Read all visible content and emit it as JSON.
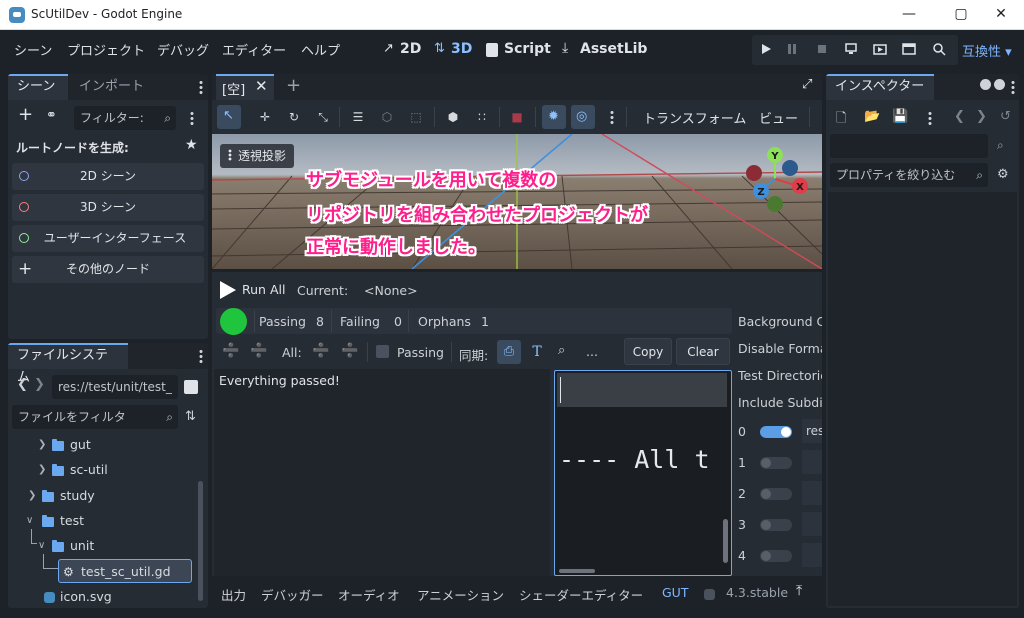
{
  "window": {
    "title": "ScUtilDev - Godot Engine"
  },
  "menu": [
    "シーン",
    "プロジェクト",
    "デバッグ",
    "エディター",
    "ヘルプ"
  ],
  "workspaces": [
    {
      "label": "2D",
      "icon": "2d-workspace-icon"
    },
    {
      "label": "3D",
      "icon": "3d-workspace-icon",
      "active": true
    },
    {
      "label": "Script",
      "icon": "script-icon"
    },
    {
      "label": "AssetLib",
      "icon": "assetlib-icon"
    }
  ],
  "compat_label": "互換性",
  "scene_dock": {
    "tabs": [
      "シーン",
      "インポート"
    ],
    "filter_placeholder": "フィルター:",
    "create_root_label": "ルートノードを生成:",
    "buttons": [
      {
        "label": "2D シーン",
        "color": "#8da5f3"
      },
      {
        "label": "3D シーン",
        "color": "#fc7f7f"
      },
      {
        "label": "ユーザーインターフェース",
        "color": "#8eef97"
      },
      {
        "label": "その他のノード",
        "color": "#e6e9ec"
      }
    ]
  },
  "filesystem": {
    "tab": "ファイルシステム",
    "path": "res://test/unit/test_",
    "filter_placeholder": "ファイルをフィルタ",
    "items": [
      {
        "label": "gut",
        "type": "folder"
      },
      {
        "label": "sc-util",
        "type": "folder"
      },
      {
        "label": "study",
        "type": "folder"
      },
      {
        "label": "test",
        "type": "folder"
      },
      {
        "label": "unit",
        "type": "folder"
      },
      {
        "label": "test_sc_util.gd",
        "type": "script",
        "selected": true
      },
      {
        "label": "icon.svg",
        "type": "svg"
      }
    ]
  },
  "viewport": {
    "tab": "[空]",
    "perspective_label": "透視投影",
    "menu_transform": "トランスフォーム",
    "menu_view": "ビュー"
  },
  "annotation": {
    "lines": [
      "サブモジュールを用いて複数の",
      "リポジトリを組み合わせたプロジェクトが",
      "正常に動作しました。"
    ]
  },
  "gut": {
    "run_all": "Run All",
    "current_label": "Current:",
    "current_value": "<None>",
    "passing_label": "Passing",
    "passing_count": "8",
    "failing_label": "Failing",
    "failing_count": "0",
    "orphans_label": "Orphans",
    "orphans_count": "1",
    "all_label": "All:",
    "passing_filter": "Passing",
    "sync_label": "同期:",
    "ellipsis": "...",
    "copy": "Copy",
    "clear": "Clear",
    "output_text": "Everything passed!",
    "console_text": "---- All t",
    "settings": [
      "Background Co",
      "Disable Forma",
      "Test Directorie",
      "Include Subdir"
    ],
    "dirs": [
      {
        "index": "0",
        "value": "res",
        "on": true
      },
      {
        "index": "1",
        "value": "",
        "on": false
      },
      {
        "index": "2",
        "value": "",
        "on": false
      },
      {
        "index": "3",
        "value": "",
        "on": false
      },
      {
        "index": "4",
        "value": "",
        "on": false
      }
    ]
  },
  "bottom_tabs": [
    "出力",
    "デバッガー",
    "オーディオ",
    "アニメーション",
    "シェーダーエディター",
    "GUT"
  ],
  "version": "4.3.stable",
  "inspector": {
    "tab": "インスペクター",
    "filter_placeholder": "プロパティを絞り込む"
  },
  "gizmo_axes": [
    "Y",
    "X",
    "Z"
  ]
}
